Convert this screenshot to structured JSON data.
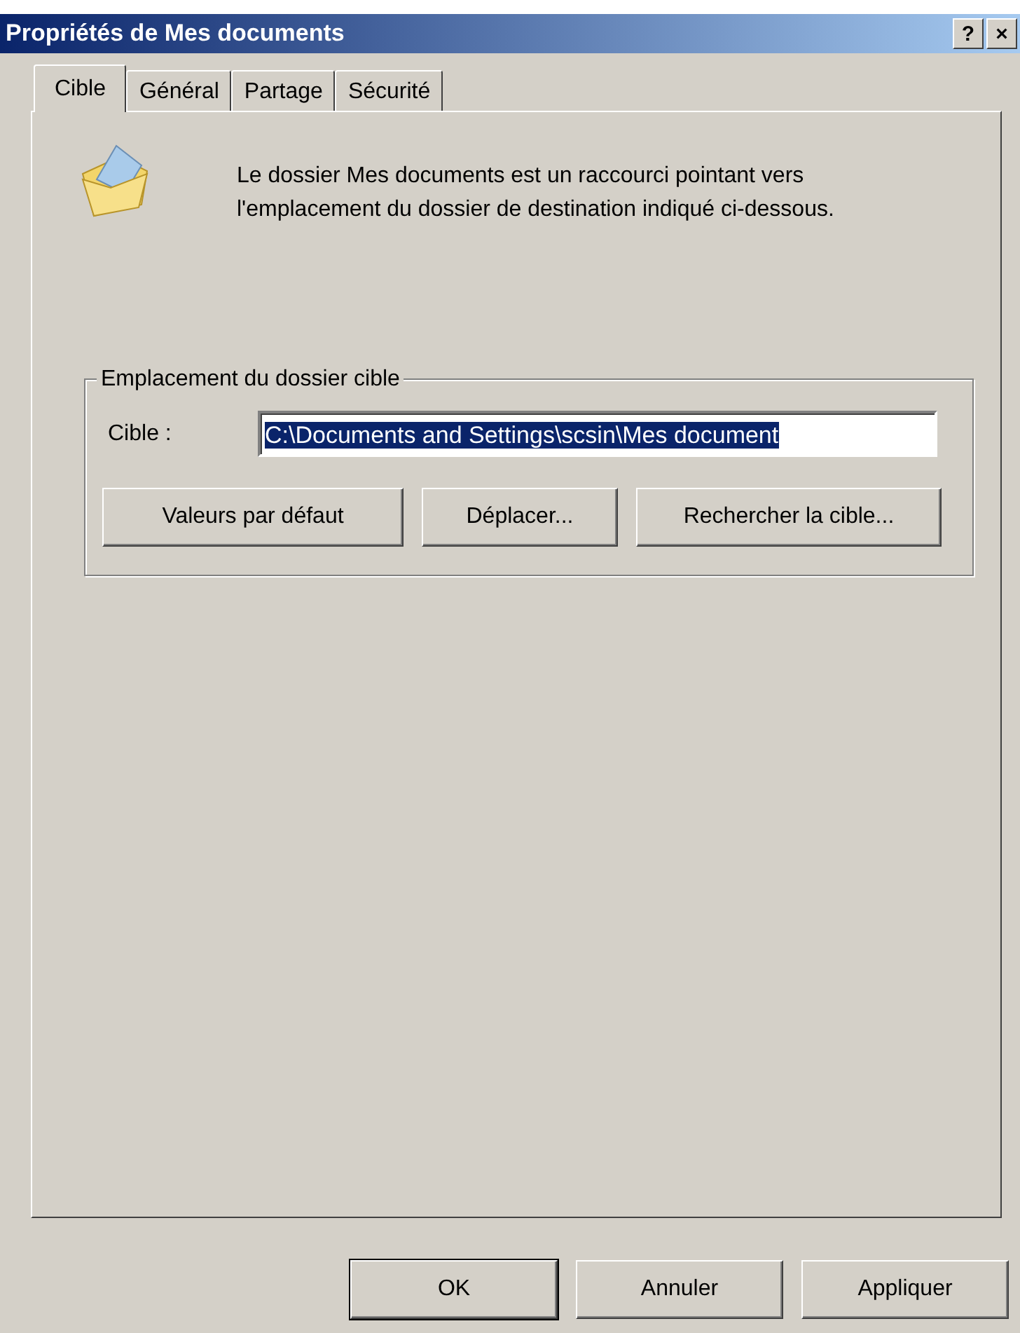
{
  "window": {
    "title": "Propriétés de Mes documents",
    "title_buttons": [
      "?",
      "×"
    ]
  },
  "tabs": [
    {
      "label": "Cible",
      "selected": true
    },
    {
      "label": "Général",
      "selected": false
    },
    {
      "label": "Partage",
      "selected": false
    },
    {
      "label": "Sécurité",
      "selected": false
    }
  ],
  "description": "Le dossier Mes documents est un raccourci pointant vers l'emplacement du dossier de destination indiqué ci-dessous.",
  "group": {
    "title": "Emplacement du dossier cible",
    "field_label": "Cible :",
    "field_value": "C:\\Documents and Settings\\scsin\\Mes document",
    "value_selected": true,
    "buttons": [
      {
        "label": "Valeurs par défaut"
      },
      {
        "label": "Déplacer..."
      },
      {
        "label": "Rechercher la cible..."
      }
    ]
  },
  "buttons": [
    {
      "label": "OK",
      "default": true
    },
    {
      "label": "Annuler",
      "default": false
    },
    {
      "label": "Appliquer",
      "default": false
    }
  ]
}
